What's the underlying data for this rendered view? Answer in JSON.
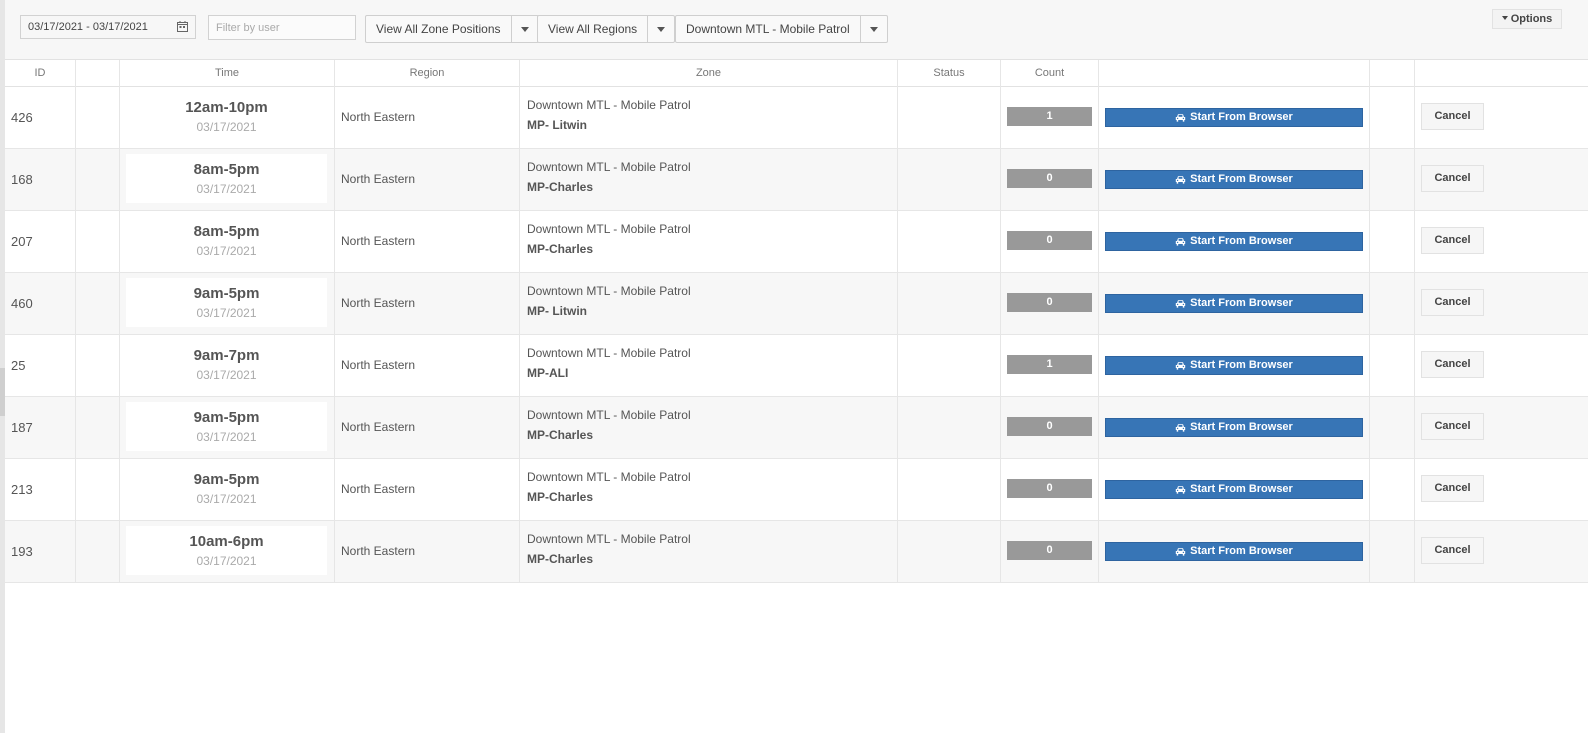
{
  "toolbar": {
    "date_range": "03/17/2021 - 03/17/2021",
    "filter_placeholder": "Filter by user",
    "zone_positions": "View All Zone Positions",
    "regions": "View All Regions",
    "zone_select": "Downtown MTL - Mobile Patrol",
    "options_label": "Options"
  },
  "columns": [
    "ID",
    "",
    "Time",
    "Region",
    "Zone",
    "Status",
    "Count",
    "",
    "",
    ""
  ],
  "start_label": "Start From Browser",
  "cancel_label": "Cancel",
  "rows": [
    {
      "id": "426",
      "time": "12am-10pm",
      "date": "03/17/2021",
      "region": "North Eastern",
      "zone": "Downtown MTL - Mobile Patrol",
      "user": "MP- Litwin",
      "count": "1"
    },
    {
      "id": "168",
      "time": "8am-5pm",
      "date": "03/17/2021",
      "region": "North Eastern",
      "zone": "Downtown MTL - Mobile Patrol",
      "user": "MP-Charles",
      "count": "0"
    },
    {
      "id": "207",
      "time": "8am-5pm",
      "date": "03/17/2021",
      "region": "North Eastern",
      "zone": "Downtown MTL - Mobile Patrol",
      "user": "MP-Charles",
      "count": "0"
    },
    {
      "id": "460",
      "time": "9am-5pm",
      "date": "03/17/2021",
      "region": "North Eastern",
      "zone": "Downtown MTL - Mobile Patrol",
      "user": "MP- Litwin",
      "count": "0"
    },
    {
      "id": "25",
      "time": "9am-7pm",
      "date": "03/17/2021",
      "region": "North Eastern",
      "zone": "Downtown MTL - Mobile Patrol",
      "user": "MP-ALI",
      "count": "1"
    },
    {
      "id": "187",
      "time": "9am-5pm",
      "date": "03/17/2021",
      "region": "North Eastern",
      "zone": "Downtown MTL - Mobile Patrol",
      "user": "MP-Charles",
      "count": "0"
    },
    {
      "id": "213",
      "time": "9am-5pm",
      "date": "03/17/2021",
      "region": "North Eastern",
      "zone": "Downtown MTL - Mobile Patrol",
      "user": "MP-Charles",
      "count": "0"
    },
    {
      "id": "193",
      "time": "10am-6pm",
      "date": "03/17/2021",
      "region": "North Eastern",
      "zone": "Downtown MTL - Mobile Patrol",
      "user": "MP-Charles",
      "count": "0"
    }
  ]
}
